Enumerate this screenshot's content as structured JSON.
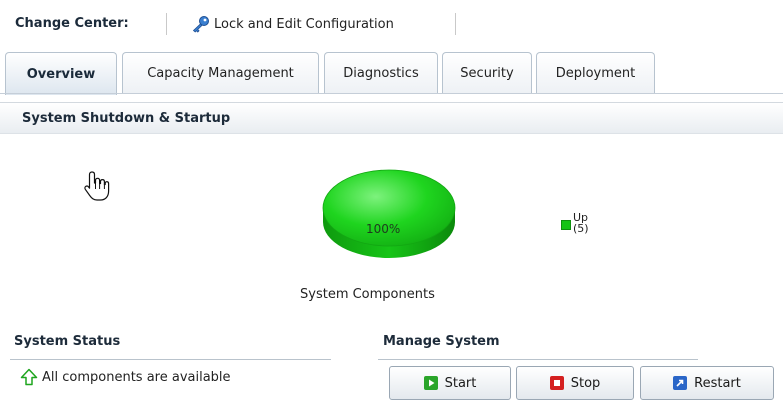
{
  "change_center": {
    "title": "Change Center:",
    "lock_link": "Lock and Edit Configuration",
    "lock_icon": "key-icon"
  },
  "tabs": [
    {
      "label": "Overview",
      "active": true
    },
    {
      "label": "Capacity Management",
      "active": false
    },
    {
      "label": "Diagnostics",
      "active": false
    },
    {
      "label": "Security",
      "active": false
    },
    {
      "label": "Deployment",
      "active": false
    }
  ],
  "section": {
    "title": "System Shutdown & Startup"
  },
  "chart_data": {
    "type": "pie",
    "categories": [
      "Up"
    ],
    "values": [
      5
    ],
    "slice_label": "100%",
    "legend": [
      {
        "label": "Up",
        "count": "(5)",
        "color": "#14c414"
      }
    ],
    "caption": "System Components"
  },
  "system_status": {
    "title": "System Status",
    "message": "All components are available",
    "icon": "up-arrow-icon"
  },
  "manage_system": {
    "title": "Manage System",
    "start_label": "Start",
    "stop_label": "Stop",
    "restart_label": "Restart"
  },
  "colors": {
    "pie": "#19d419",
    "start": "#2aa52a",
    "stop": "#d42020",
    "restart": "#2a66c8"
  }
}
